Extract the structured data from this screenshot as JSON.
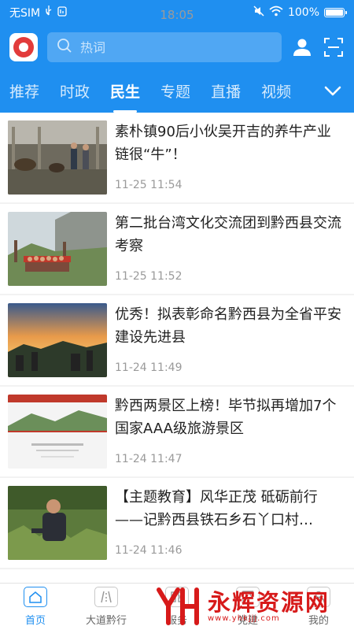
{
  "status_bar": {
    "carrier": "无SIM",
    "time": "18:05",
    "battery": "100%"
  },
  "header": {
    "search_placeholder": "热词",
    "tabs": [
      {
        "label": "推荐",
        "active": false
      },
      {
        "label": "时政",
        "active": false
      },
      {
        "label": "民生",
        "active": true
      },
      {
        "label": "专题",
        "active": false
      },
      {
        "label": "直播",
        "active": false
      },
      {
        "label": "视频",
        "active": false
      }
    ]
  },
  "news": [
    {
      "title": "素朴镇90后小伙吴开吉的养牛产业链很“牛”！",
      "time": "11-25 11:54"
    },
    {
      "title": "第二批台湾文化交流团到黔西县交流考察",
      "time": "11-25 11:52"
    },
    {
      "title": "优秀！拟表彰命名黔西县为全省平安建设先进县",
      "time": "11-24 11:49"
    },
    {
      "title": "黔西两景区上榜！毕节拟再增加7个国家AAA级旅游景区",
      "time": "11-24 11:47"
    },
    {
      "title": "【主题教育】风华正茂 砥砺前行——记黔西县铁石乡石丫口村…",
      "time": "11-24 11:46"
    }
  ],
  "bottom_nav": [
    {
      "label": "首页",
      "icon_text": "首页",
      "active": true
    },
    {
      "label": "大道黔行",
      "icon_text": "大道黔行",
      "active": false
    },
    {
      "label": "服务",
      "icon_text": "服务",
      "active": false
    },
    {
      "label": "党建",
      "icon_text": "党建",
      "active": false
    },
    {
      "label": "我的",
      "icon_text": "我的",
      "active": false
    }
  ],
  "watermark": {
    "text": "永辉资源网",
    "url": "www.yhkjjj.com"
  },
  "colors": {
    "brand": "#1f8ff0",
    "watermark": "#d71a1a"
  }
}
